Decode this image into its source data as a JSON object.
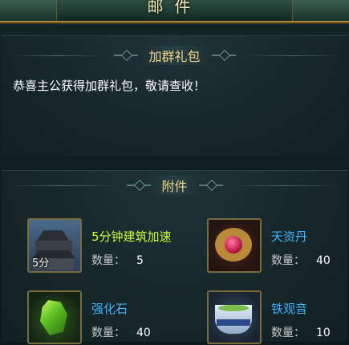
{
  "header": {
    "title": "邮件"
  },
  "mail": {
    "subject": "加群礼包",
    "body": "恭喜主公获得加群礼包，敬请查收！",
    "attachments_title": "附件"
  },
  "quantity_label": "数量：",
  "attachments": [
    {
      "name": "5分钟建筑加速",
      "name_color": "#c8ff3a",
      "quantity": "5",
      "icon": "castle-icon",
      "icon_tag": "5分"
    },
    {
      "name": "天资丹",
      "name_color": "#3fb4ff",
      "quantity": "40",
      "icon": "pill-icon"
    },
    {
      "name": "强化石",
      "name_color": "#3fb4ff",
      "quantity": "40",
      "icon": "gem-icon"
    },
    {
      "name": "铁观音",
      "name_color": "#3fb4ff",
      "quantity": "10",
      "icon": "tea-cup-icon"
    }
  ]
}
